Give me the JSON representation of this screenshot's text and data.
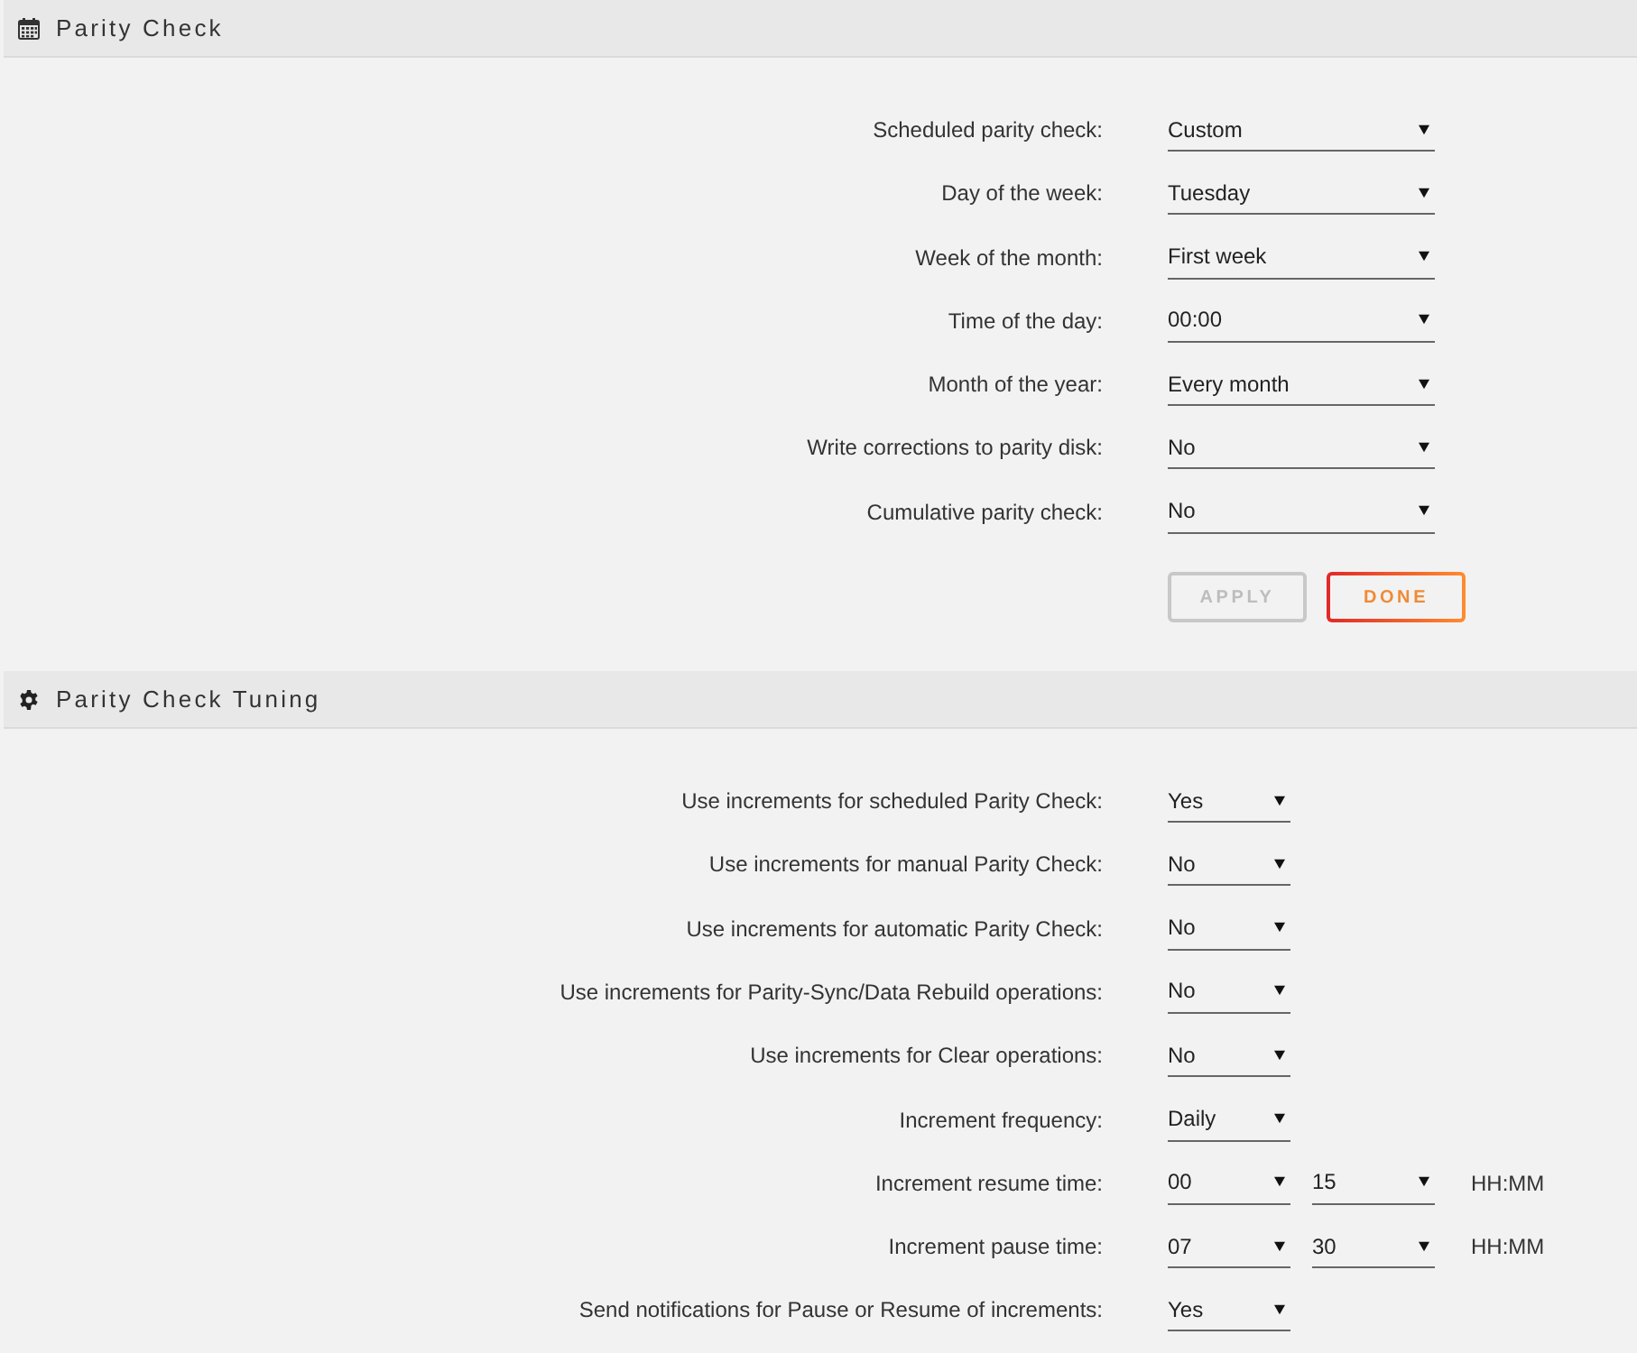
{
  "sections": [
    {
      "title": "Parity Check",
      "fields": [
        {
          "label": "Scheduled parity check:",
          "selects": [
            {
              "value": "Custom"
            }
          ]
        },
        {
          "label": "Day of the week:",
          "selects": [
            {
              "value": "Tuesday"
            }
          ]
        },
        {
          "label": "Week of the month:",
          "selects": [
            {
              "value": "First week"
            }
          ]
        },
        {
          "label": "Time of the day:",
          "selects": [
            {
              "value": "00:00"
            }
          ]
        },
        {
          "label": "Month of the year:",
          "selects": [
            {
              "value": "Every month"
            }
          ]
        },
        {
          "label": "Write corrections to parity disk:",
          "selects": [
            {
              "value": "No"
            }
          ]
        },
        {
          "label": "Cumulative parity check:",
          "selects": [
            {
              "value": "No"
            }
          ]
        }
      ],
      "buttons": [
        {
          "label": "APPLY",
          "disabled": true
        },
        {
          "label": "DONE",
          "disabled": false
        }
      ]
    },
    {
      "title": "Parity Check Tuning",
      "fields": [
        {
          "label": "Use increments for scheduled Parity Check:",
          "selects": [
            {
              "value": "Yes"
            }
          ]
        },
        {
          "label": "Use increments for manual Parity Check:",
          "selects": [
            {
              "value": "No"
            }
          ]
        },
        {
          "label": "Use increments for automatic Parity Check:",
          "selects": [
            {
              "value": "No"
            }
          ]
        },
        {
          "label": "Use increments for Parity-Sync/Data Rebuild operations:",
          "selects": [
            {
              "value": "No"
            }
          ]
        },
        {
          "label": "Use increments for Clear operations:",
          "selects": [
            {
              "value": "No"
            }
          ]
        },
        {
          "label": "Increment frequency:",
          "selects": [
            {
              "value": "Daily"
            }
          ]
        },
        {
          "label": "Increment resume time:",
          "selects": [
            {
              "value": "00"
            },
            {
              "value": "15"
            }
          ],
          "unit": "HH:MM"
        },
        {
          "label": "Increment pause time:",
          "selects": [
            {
              "value": "07"
            },
            {
              "value": "30"
            }
          ],
          "unit": "HH:MM"
        },
        {
          "label": "Send notifications for Pause or Resume of increments:",
          "selects": [
            {
              "value": "Yes"
            }
          ]
        }
      ]
    }
  ]
}
